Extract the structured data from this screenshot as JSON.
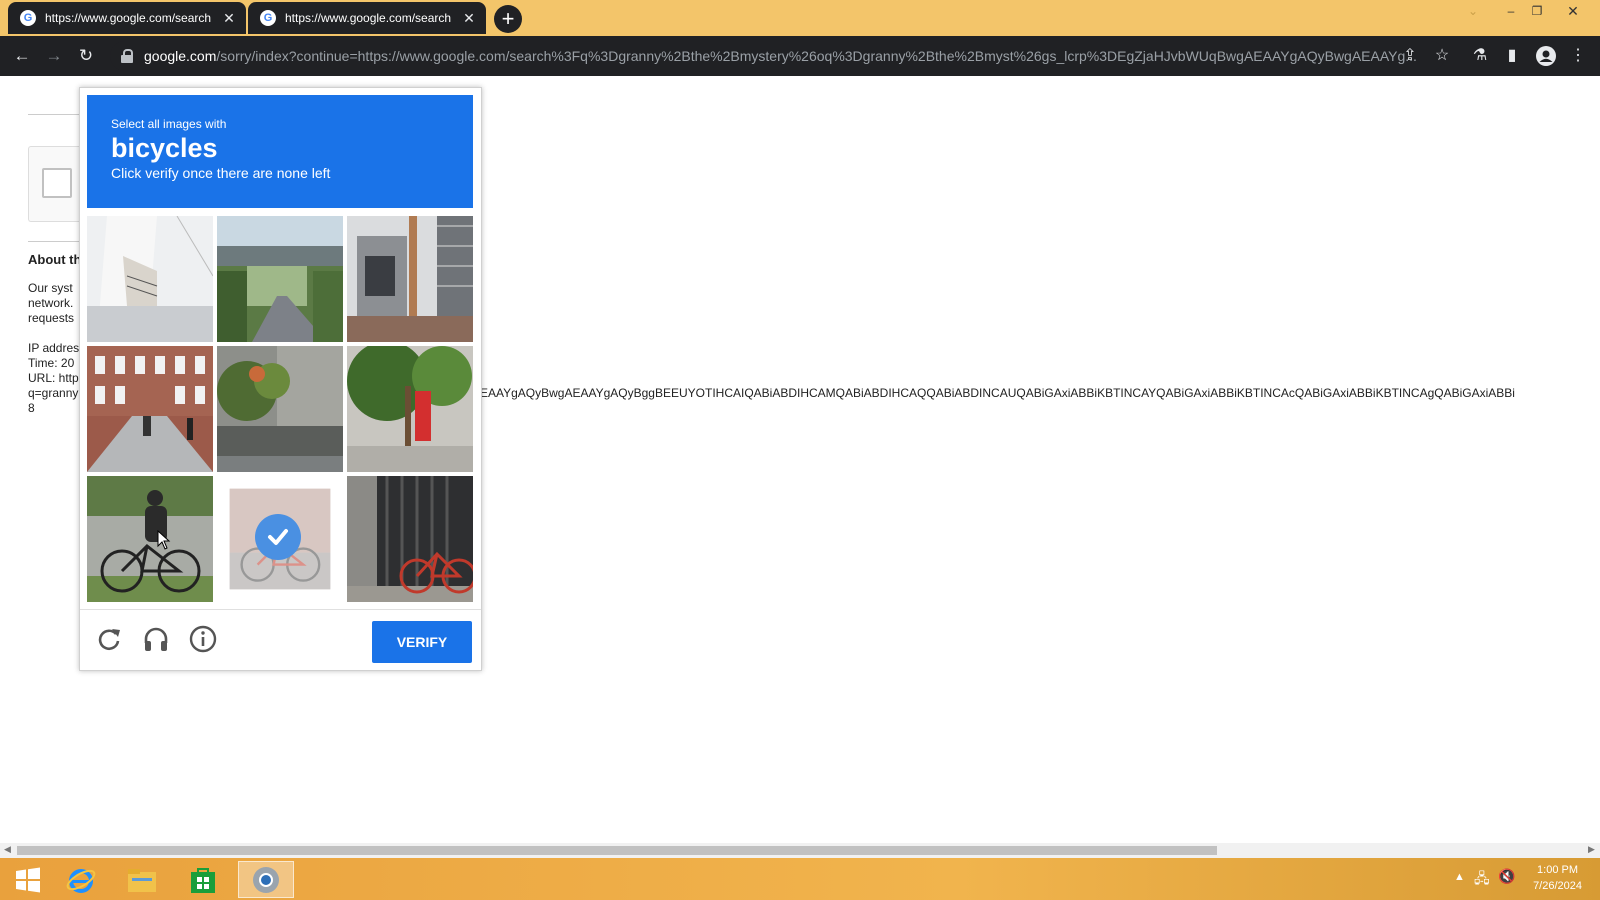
{
  "browser": {
    "tabs": [
      {
        "title": "https://www.google.com/search",
        "active": true
      },
      {
        "title": "https://www.google.com/search",
        "active": false
      }
    ],
    "new_tab_label": "+",
    "url_host": "google.com",
    "url_rest": "/sorry/index?continue=https://www.google.com/search%3Fq%3Dgranny%2Bthe%2Bmystery%26oq%3Dgranny%2Bthe%2Bmyst%26gs_lcrp%3DEgZjaHJvbWUqBwgAEAAYgAQyBwgAEAAYg..."
  },
  "page": {
    "about_heading": "About th",
    "para_lines": [
      "Our syst",
      "network.",
      "requests"
    ],
    "ip_lines": [
      "IP addres",
      "Time: 20",
      "URL: http",
      "q=granny",
      "8"
    ],
    "long_url_fragment": "EAAYgAQyBwgAEAAYgAQyBggBEEUYOTIHCAIQABiABDIHCAMQABiABDIHCAQQABiABDINCAUQABiGAxiABBiKBTINCAYQABiGAxiABBiKBTINCAcQABiGAxiABBiKBTINCAgQABiGAxiABBi"
  },
  "captcha": {
    "instruction_line1": "Select all images with",
    "target": "bicycles",
    "instruction_line3": "Click verify once there are none left",
    "verify_label": "VERIFY",
    "tiles": [
      {
        "name": "tile-1-building-balcony",
        "selected": false
      },
      {
        "name": "tile-2-bridge-road",
        "selected": false
      },
      {
        "name": "tile-3-building-stairs",
        "selected": false
      },
      {
        "name": "tile-4-street-buildings",
        "selected": false
      },
      {
        "name": "tile-5-plants-wall",
        "selected": false
      },
      {
        "name": "tile-6-tree-sidewalk",
        "selected": false
      },
      {
        "name": "tile-7-cyclist",
        "selected": false
      },
      {
        "name": "tile-8-bicycle",
        "selected": true
      },
      {
        "name": "tile-9-parked-bicycle",
        "selected": false
      }
    ]
  },
  "taskbar": {
    "time": "1:00 PM",
    "date": "7/26/2024"
  },
  "colors": {
    "captcha_blue": "#1a73e8",
    "titlebar": "#f3c56a",
    "chrome_dark": "#202124"
  }
}
